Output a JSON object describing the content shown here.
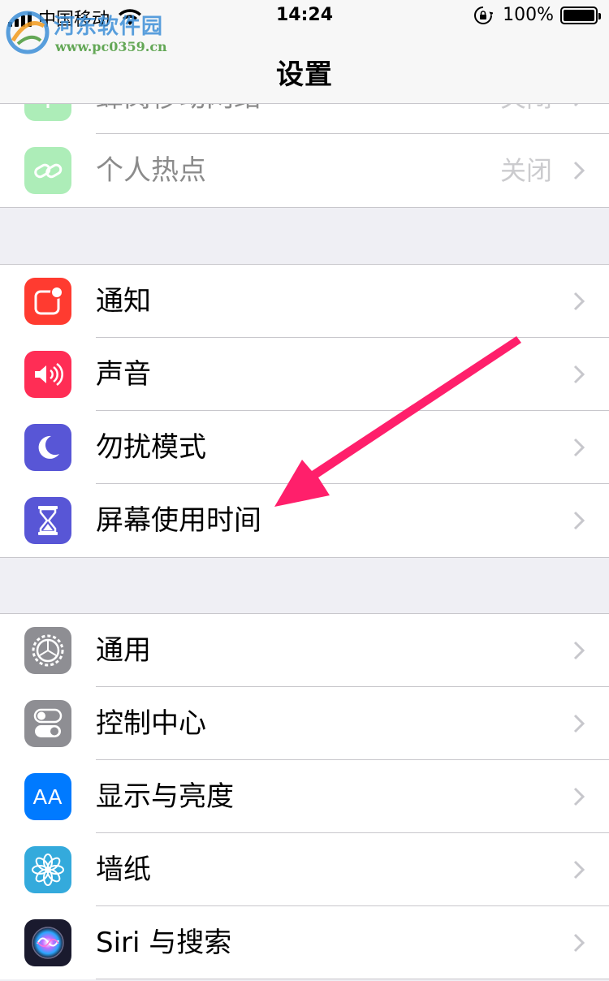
{
  "status_bar": {
    "carrier": "中国移动",
    "time": "14:24",
    "battery_pct": "100%",
    "battery_level": 1.0
  },
  "nav": {
    "title": "设置"
  },
  "watermark": {
    "title": "河东软件园",
    "url": "www.pc0359.cn"
  },
  "group_network": {
    "items": [
      {
        "label": "蜂窝移动网络",
        "value": "关闭",
        "icon": "cellular-icon",
        "color": "#4cd964"
      },
      {
        "label": "个人热点",
        "value": "关闭",
        "icon": "hotspot-icon",
        "color": "#4cd964"
      }
    ]
  },
  "group_alerts": {
    "items": [
      {
        "label": "通知",
        "icon": "notifications-icon",
        "color": "#ff3b30"
      },
      {
        "label": "声音",
        "icon": "sound-icon",
        "color": "#ff2d55"
      },
      {
        "label": "勿扰模式",
        "icon": "moon-icon",
        "color": "#5856d6"
      },
      {
        "label": "屏幕使用时间",
        "icon": "hourglass-icon",
        "color": "#5856d6"
      }
    ]
  },
  "group_general": {
    "items": [
      {
        "label": "通用",
        "icon": "gear-icon",
        "color": "#8e8e93"
      },
      {
        "label": "控制中心",
        "icon": "toggles-icon",
        "color": "#8e8e93"
      },
      {
        "label": "显示与亮度",
        "icon": "text-size-icon",
        "color": "#007aff"
      },
      {
        "label": "墙纸",
        "icon": "flower-icon",
        "color": "#34aadc"
      },
      {
        "label": "Siri 与搜索",
        "icon": "siri-icon",
        "color": "#1a1a2e"
      }
    ]
  },
  "annotation": {
    "color": "#ff1f6b",
    "icon": "arrow-annotation"
  },
  "icons_text": {
    "display_icon": "AA"
  }
}
